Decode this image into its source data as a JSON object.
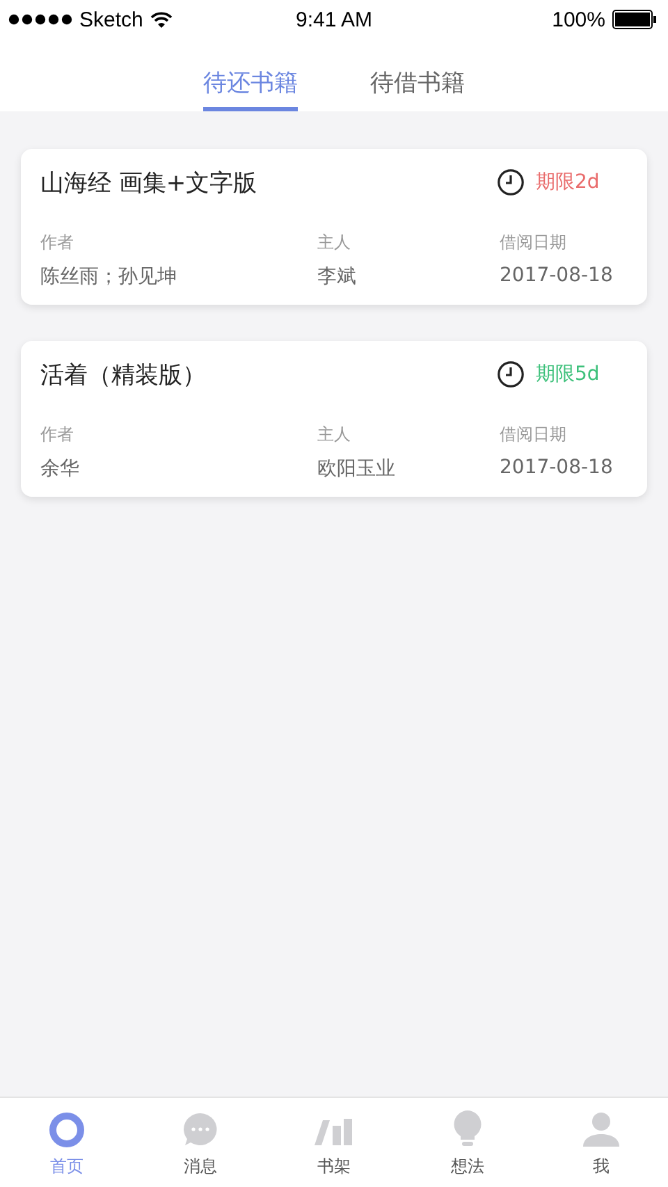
{
  "status_bar": {
    "carrier": "Sketch",
    "time": "9:41 AM",
    "battery": "100%"
  },
  "tabs": [
    {
      "label": "待还书籍",
      "selected": true
    },
    {
      "label": "待借书籍",
      "selected": false
    }
  ],
  "books": [
    {
      "title": "山海经 画集+文字版",
      "deadline": "期限2d",
      "color": "#e96b6b",
      "author_label": "作者",
      "author": "陈丝雨；孙见坤",
      "owner_label": "主人",
      "owner": "李斌",
      "date_label": "借阅日期",
      "date": "2017-08-18"
    },
    {
      "title": "活着（精装版）",
      "deadline": "期限5d",
      "color": "#3cc07a",
      "author_label": "作者",
      "author": "余华",
      "owner_label": "主人",
      "owner": "欧阳玉业",
      "date_label": "借阅日期",
      "date": "2017-08-18"
    }
  ],
  "tab_bar": [
    {
      "kind": "ring",
      "label": "首页",
      "selected": true
    },
    {
      "kind": "chat",
      "label": "消息",
      "selected": false
    },
    {
      "kind": "shelf",
      "label": "书架",
      "selected": false
    },
    {
      "kind": "bulb",
      "label": "想法",
      "selected": false
    },
    {
      "kind": "person",
      "label": "我",
      "selected": false
    }
  ]
}
